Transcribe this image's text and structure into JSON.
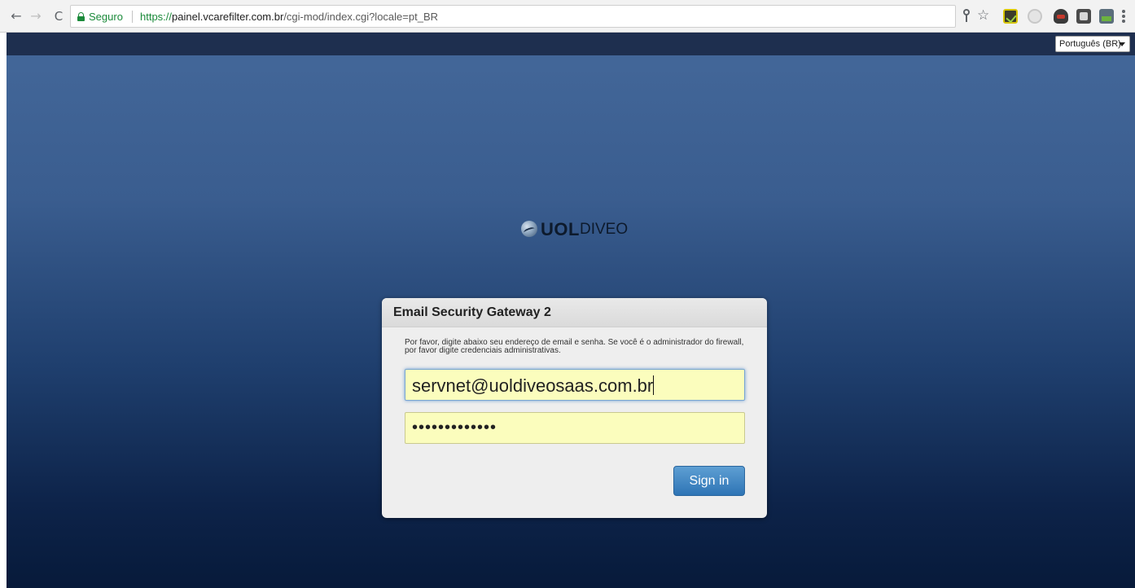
{
  "browser": {
    "secure_label": "Seguro",
    "url_scheme": "https://",
    "url_host": "painel.vcarefilter.com.br",
    "url_path": "/cgi-mod/index.cgi?locale=pt_BR",
    "nav_back": "←",
    "nav_forward": "→",
    "nav_reload": "C",
    "star": "☆"
  },
  "page": {
    "locale_selected": "Português (BR)",
    "logo": {
      "brand": "UOL",
      "sub": "DIVEO"
    },
    "login": {
      "title": "Email Security Gateway 2",
      "instructions": "Por favor, digite abaixo seu endereço de email e senha. Se você é o administrador do firewall, por favor digite credenciais administrativas.",
      "email_value": "servnet@uoldiveosaas.com.br",
      "password_masked": "•••••••••••••",
      "signin_label": "Sign in"
    }
  }
}
